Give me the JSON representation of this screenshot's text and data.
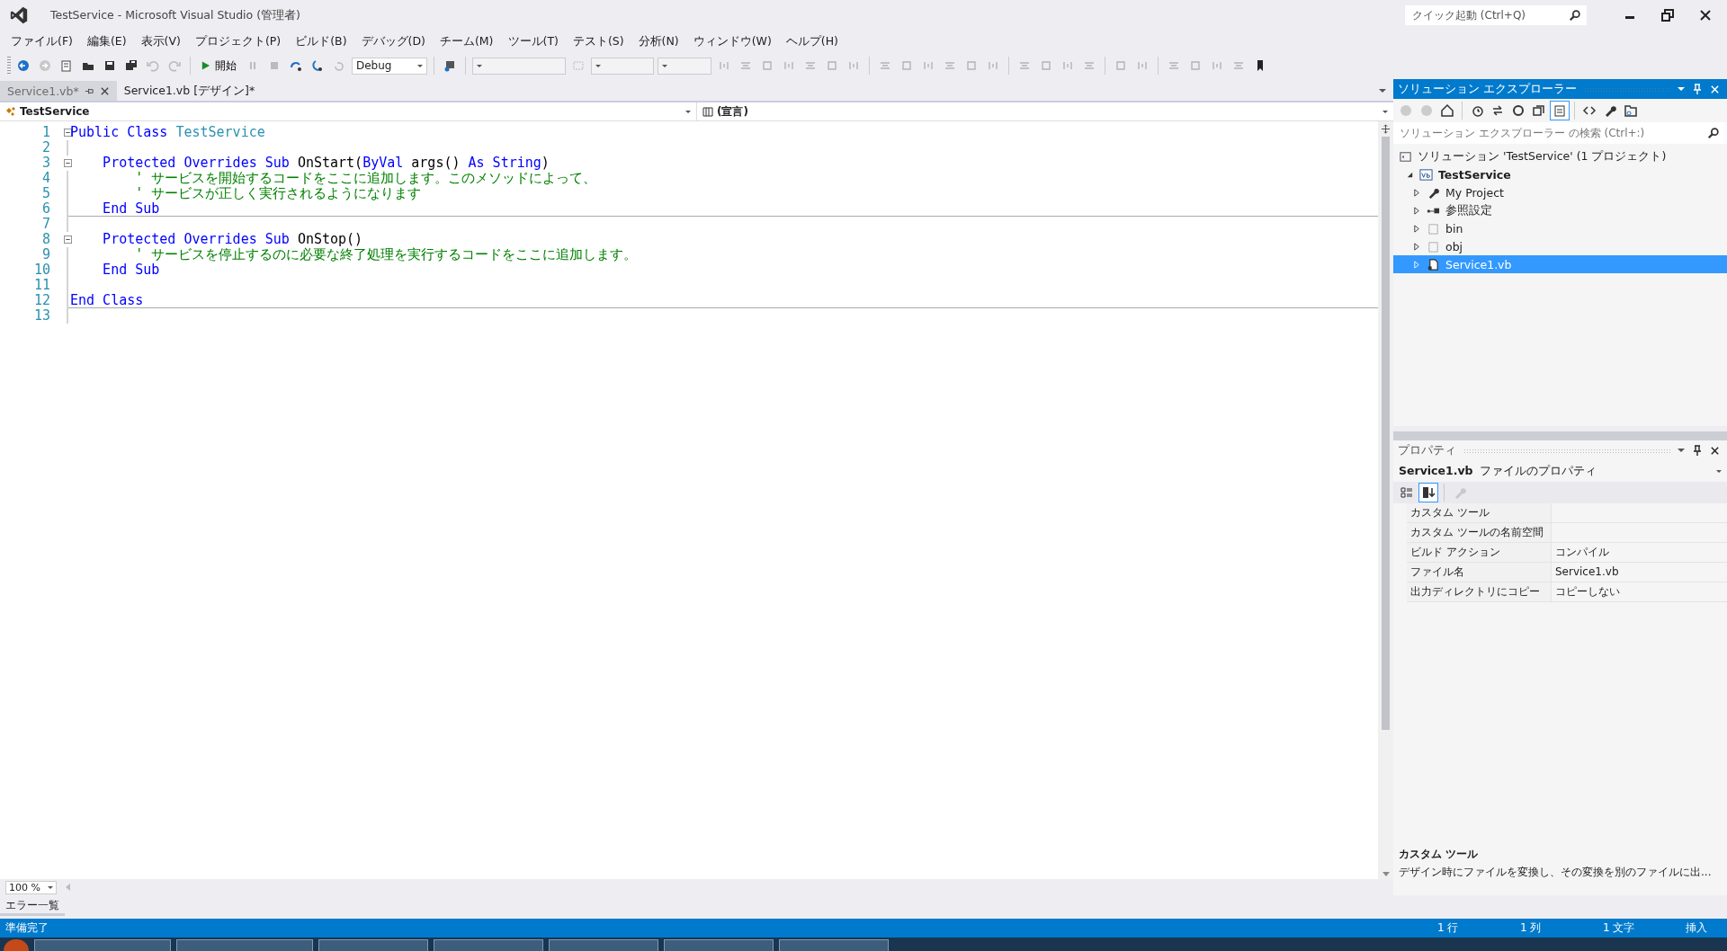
{
  "window": {
    "title": "TestService - Microsoft Visual Studio (管理者)"
  },
  "quick_launch": {
    "placeholder": "クイック起動 (Ctrl+Q)"
  },
  "menu": [
    "ファイル(F)",
    "編集(E)",
    "表示(V)",
    "プロジェクト(P)",
    "ビルド(B)",
    "デバッグ(D)",
    "チーム(M)",
    "ツール(T)",
    "テスト(S)",
    "分析(N)",
    "ウィンドウ(W)",
    "ヘルプ(H)"
  ],
  "toolbar": {
    "start_label": "開始",
    "configuration": "Debug"
  },
  "tabs": [
    {
      "label": "Service1.vb*",
      "selected": true
    },
    {
      "label": "Service1.vb [デザイン]*",
      "selected": false
    }
  ],
  "nav": {
    "type": "TestService",
    "member": "(宣言)"
  },
  "code": [
    {
      "number": "1",
      "fold": true,
      "divider": false,
      "tokens": [
        {
          "kind": "keyword",
          "text": "Public Class "
        },
        {
          "kind": "type",
          "text": "TestService"
        }
      ]
    },
    {
      "number": "2",
      "fold": false,
      "divider": false
    },
    {
      "number": "3",
      "fold": true,
      "divider": false,
      "tokens": [
        {
          "kind": "keyword",
          "text": "    Protected Overrides Sub "
        },
        {
          "kind": "plain",
          "text": "OnStart("
        },
        {
          "kind": "keyword",
          "text": "ByVal"
        },
        {
          "kind": "plain",
          "text": " args() "
        },
        {
          "kind": "keyword",
          "text": "As String"
        },
        {
          "kind": "plain",
          "text": ")"
        }
      ]
    },
    {
      "number": "4",
      "fold": false,
      "divider": false,
      "tokens": [
        {
          "kind": "comment",
          "text": "        ' サービスを開始するコードをここに追加します。このメソッドによって、"
        }
      ]
    },
    {
      "number": "5",
      "fold": false,
      "divider": false,
      "tokens": [
        {
          "kind": "comment",
          "text": "        ' サービスが正しく実行されるようになります"
        }
      ]
    },
    {
      "number": "6",
      "fold": false,
      "divider": true,
      "tokens": [
        {
          "kind": "keyword",
          "text": "    End Sub"
        }
      ]
    },
    {
      "number": "7",
      "fold": false,
      "divider": false
    },
    {
      "number": "8",
      "fold": true,
      "divider": false,
      "tokens": [
        {
          "kind": "keyword",
          "text": "    Protected Overrides Sub "
        },
        {
          "kind": "plain",
          "text": "OnStop()"
        }
      ]
    },
    {
      "number": "9",
      "fold": false,
      "divider": false,
      "tokens": [
        {
          "kind": "comment",
          "text": "        ' サービスを停止するのに必要な終了処理を実行するコードをここに追加します。"
        }
      ]
    },
    {
      "number": "10",
      "fold": false,
      "divider": false,
      "tokens": [
        {
          "kind": "keyword",
          "text": "    End Sub"
        }
      ]
    },
    {
      "number": "11",
      "fold": false,
      "divider": false
    },
    {
      "number": "12",
      "fold": false,
      "divider": true,
      "tokens": [
        {
          "kind": "keyword",
          "text": "End Class"
        }
      ]
    },
    {
      "number": "13",
      "fold": false,
      "divider": false
    }
  ],
  "zoom": "100 %",
  "solution_explorer": {
    "title": "ソリューション エクスプローラー",
    "search_placeholder": "ソリューション エクスプローラー の検索 (Ctrl+:)",
    "tree": [
      {
        "label": "ソリューション 'TestService' (1 プロジェクト)",
        "kind": "solution",
        "selected": false,
        "children": [
          {
            "label": "TestService",
            "kind": "project",
            "expanded": true,
            "selected": false,
            "children": [
              {
                "label": "My Project",
                "kind": "settings",
                "expanded": false,
                "selected": false
              },
              {
                "label": "参照設定",
                "kind": "references",
                "expanded": false,
                "selected": false
              },
              {
                "label": "bin",
                "kind": "folder",
                "expanded": false,
                "selected": false
              },
              {
                "label": "obj",
                "kind": "folder",
                "expanded": false,
                "selected": false
              },
              {
                "label": "Service1.vb",
                "kind": "file",
                "expanded": false,
                "selected": true
              }
            ]
          }
        ]
      }
    ]
  },
  "properties": {
    "title": "プロパティ",
    "object": "Service1.vb",
    "object_type": "ファイルのプロパティ",
    "rows": [
      {
        "name": "カスタム ツール"
      },
      {
        "name": "カスタム ツールの名前空間"
      },
      {
        "name": "ビルド アクション",
        "value": "コンパイル"
      },
      {
        "name": "ファイル名",
        "value": "Service1.vb"
      },
      {
        "name": "出力ディレクトリにコピー",
        "value": "コピーしない"
      }
    ],
    "description_title": "カスタム ツール",
    "description": "デザイン時にファイルを変換し、その変換を別のファイルに出..."
  },
  "error_list_tab": "エラー一覧",
  "status_bar": {
    "message": "準備完了",
    "line": "1 行",
    "column": "1 列",
    "char": "1 文字",
    "mode": "挿入"
  }
}
